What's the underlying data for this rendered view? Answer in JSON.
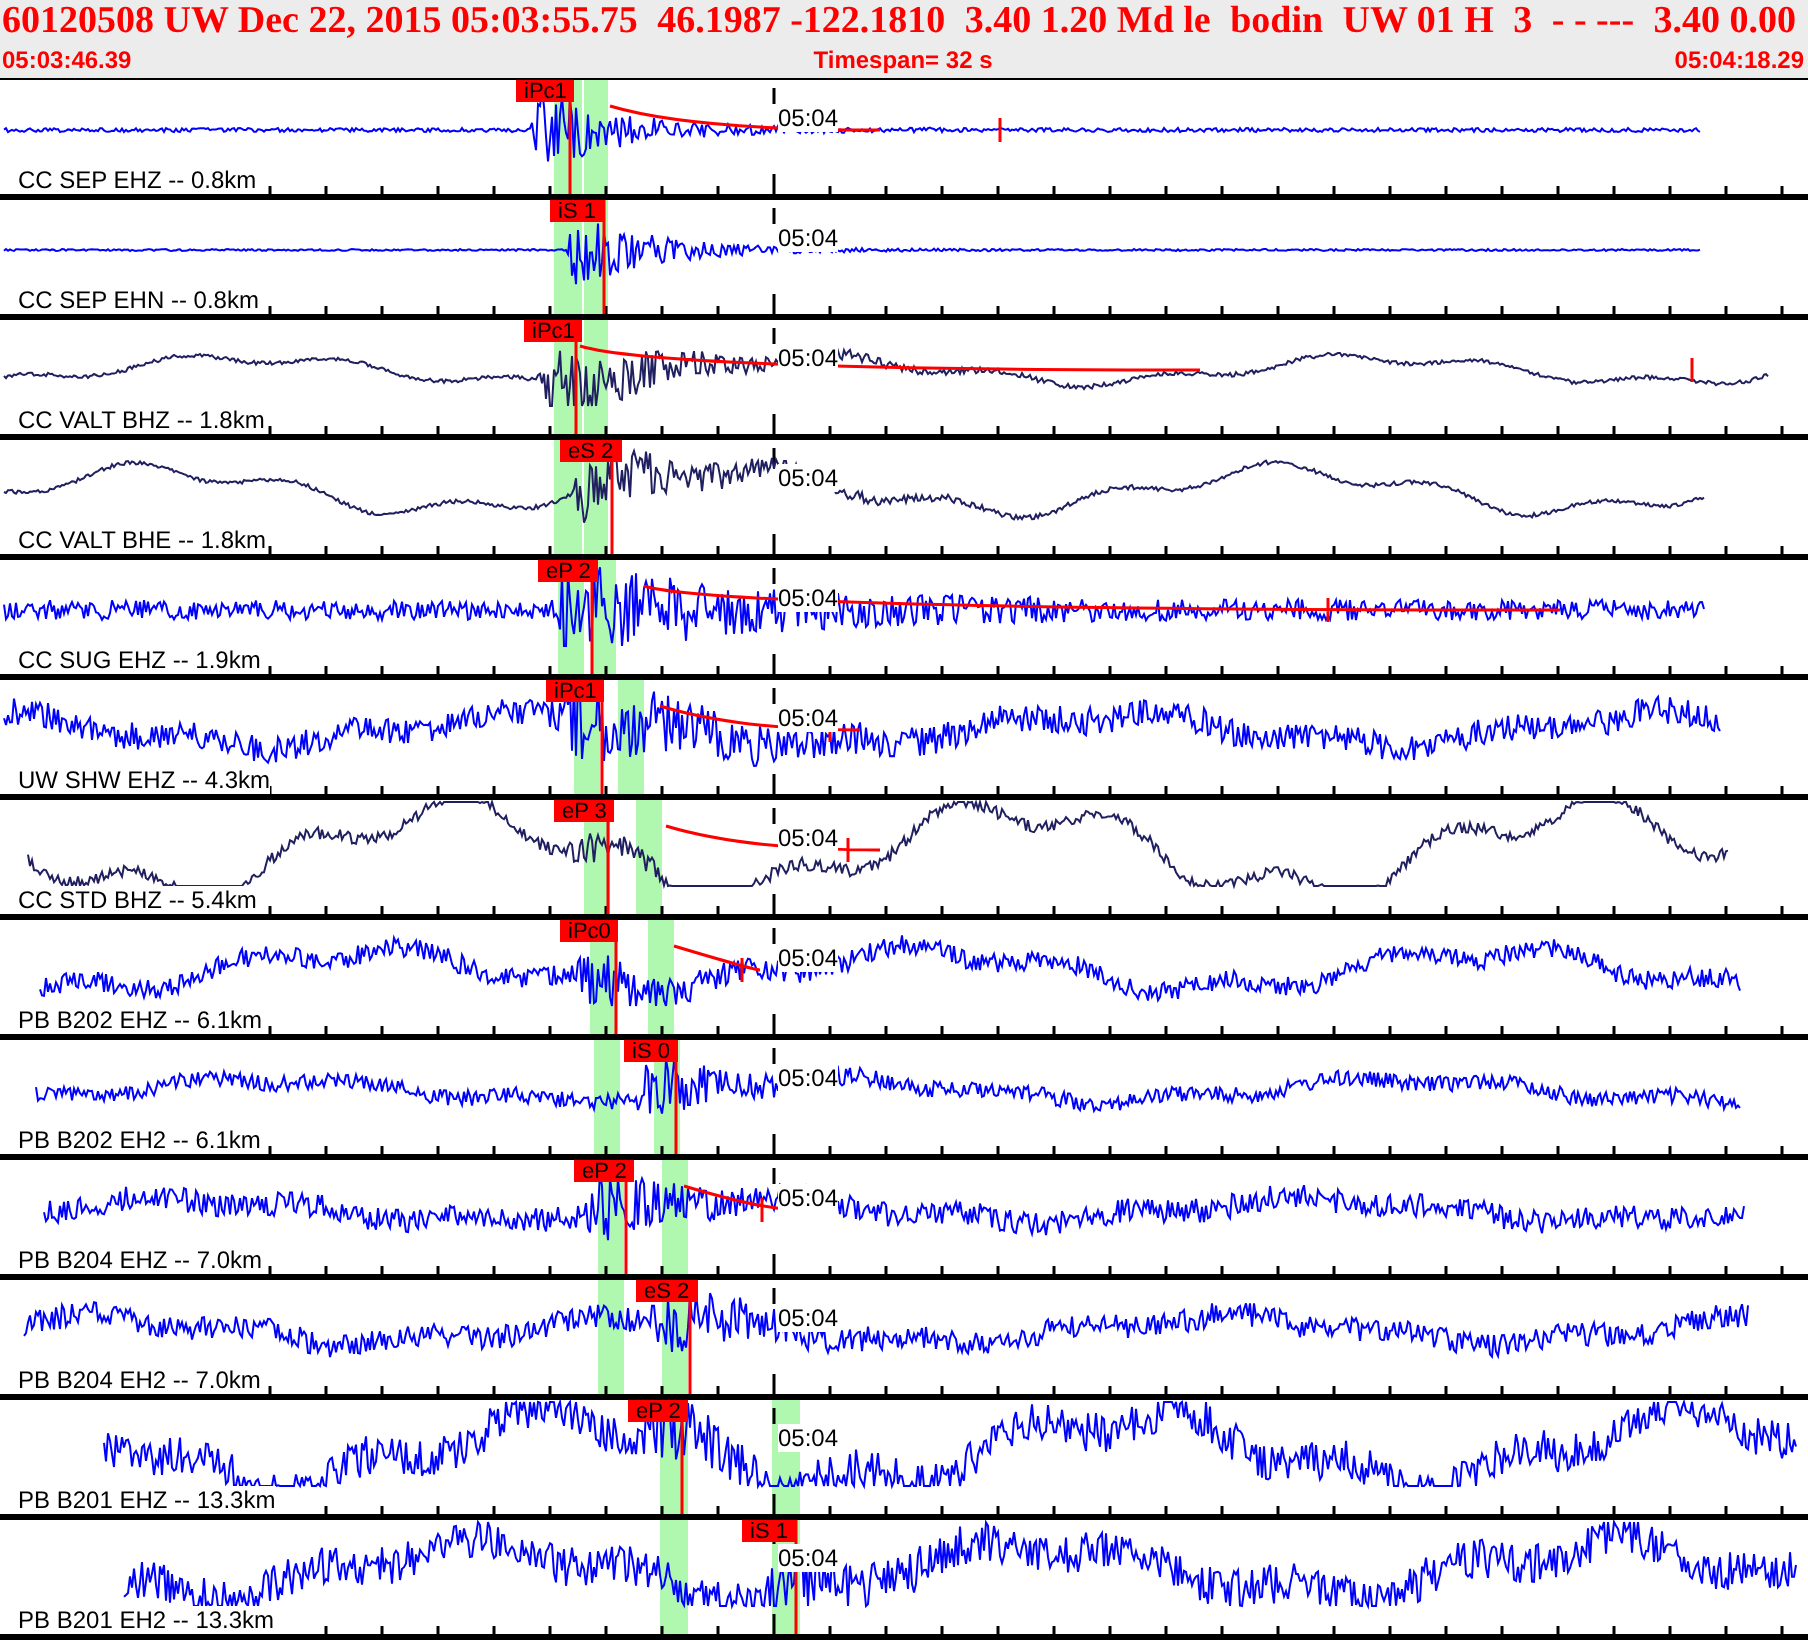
{
  "header": {
    "event_fields": [
      "60120508 UW Dec 22, 2015 05:03:55.75",
      "46.1987 -122.1810",
      "3.40 1.20 Md le",
      "bodin",
      "UW 01 H",
      "3",
      "- - ---",
      "3.40 0.00"
    ],
    "start_time": "05:03:46.39",
    "timespan": "Timespan=  32 s",
    "end_time": "05:04:18.29"
  },
  "traces": [
    {
      "station": "CC SEP EHZ -- 0.8km",
      "pick": "iPc1",
      "time_label": "05:04",
      "color": "#0000ff"
    },
    {
      "station": "CC SEP EHN -- 0.8km",
      "pick": "iS 1",
      "time_label": "05:04",
      "color": "#0000ff"
    },
    {
      "station": "CC VALT BHZ -- 1.8km",
      "pick": "iPc1",
      "time_label": "05:04",
      "color": "#202060"
    },
    {
      "station": "CC VALT BHE -- 1.8km",
      "pick": "eS 2",
      "time_label": "05:04",
      "color": "#202060"
    },
    {
      "station": "CC SUG EHZ -- 1.9km",
      "pick": "eP 2",
      "time_label": "05:04",
      "color": "#0000ff"
    },
    {
      "station": "UW SHW EHZ -- 4.3km",
      "pick": "iPc1",
      "time_label": "05:04",
      "color": "#0000ff"
    },
    {
      "station": "CC STD BHZ -- 5.4km",
      "pick": "eP 3",
      "time_label": "05:04",
      "color": "#202060"
    },
    {
      "station": "PB B202 EHZ -- 6.1km",
      "pick": "iPc0",
      "time_label": "05:04",
      "color": "#0000ff"
    },
    {
      "station": "PB B202 EH2 -- 6.1km",
      "pick": "iS 0",
      "time_label": "05:04",
      "color": "#0000ff"
    },
    {
      "station": "PB B204 EHZ -- 7.0km",
      "pick": "eP 2",
      "time_label": "05:04",
      "color": "#0000ff"
    },
    {
      "station": "PB B204 EH2 -- 7.0km",
      "pick": "eS 2",
      "time_label": "05:04",
      "color": "#0000ff"
    },
    {
      "station": "PB B201 EHZ -- 13.3km",
      "pick": "eP 2",
      "time_label": "05:04",
      "color": "#0000ff"
    },
    {
      "station": "PB B201 EH2 -- 13.3km",
      "pick": "iS 1",
      "time_label": "05:04",
      "color": "#0000ff"
    }
  ]
}
